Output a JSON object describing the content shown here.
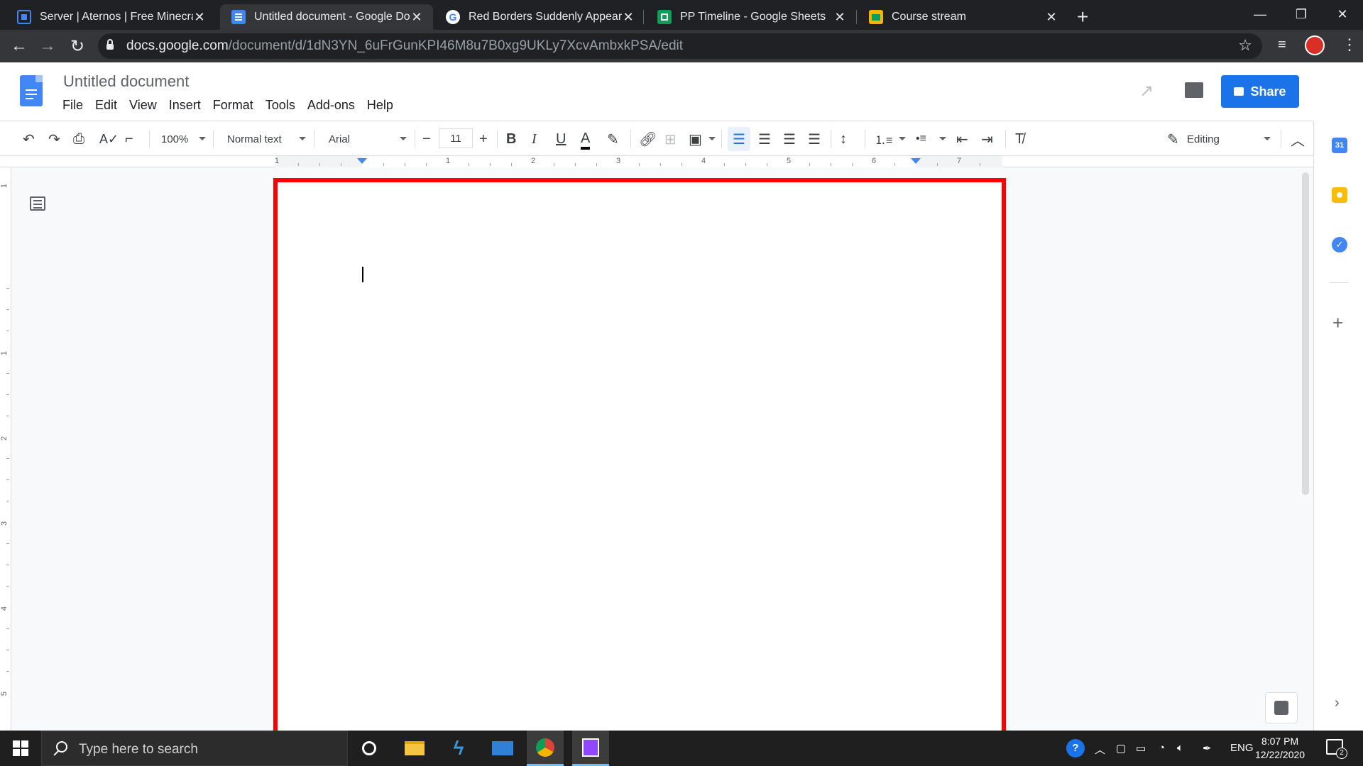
{
  "browser": {
    "tabs": [
      {
        "title": "Server | Aternos | Free Minecraft",
        "favicon": "aternos-icon",
        "active": false
      },
      {
        "title": "Untitled document - Google Docs",
        "favicon": "google-docs-icon",
        "active": true
      },
      {
        "title": "Red Borders Suddenly Appearing",
        "favicon": "google-icon",
        "active": false
      },
      {
        "title": "PP Timeline - Google Sheets",
        "favicon": "google-sheets-icon",
        "active": false
      },
      {
        "title": "Course stream",
        "favicon": "google-classroom-icon",
        "active": false
      }
    ],
    "url_host": "docs.google.com",
    "url_path": "/document/d/1dN3YN_6uFrGunKPI46M8u7B0xg9UKLy7XcvAmbxkPSA/edit"
  },
  "docs": {
    "title": "Untitled document",
    "menu": [
      "File",
      "Edit",
      "View",
      "Insert",
      "Format",
      "Tools",
      "Add-ons",
      "Help"
    ],
    "share_label": "Share",
    "toolbar": {
      "zoom": "100%",
      "style": "Normal text",
      "font": "Arial",
      "font_size": "11",
      "mode": "Editing"
    },
    "ruler_numbers": [
      "1",
      "1",
      "2",
      "3",
      "4",
      "5",
      "6",
      "7"
    ],
    "vruler_numbers": [
      "1",
      "1",
      "2",
      "3",
      "4",
      "5"
    ]
  },
  "taskbar": {
    "search_placeholder": "Type here to search",
    "language": "ENG",
    "time": "8:07 PM",
    "date": "12/22/2020",
    "notification_count": "2"
  },
  "colors": {
    "docs_blue": "#4285f4",
    "share_blue": "#1a73e8",
    "page_border": "#ff0000",
    "chrome_dark": "#202124"
  }
}
